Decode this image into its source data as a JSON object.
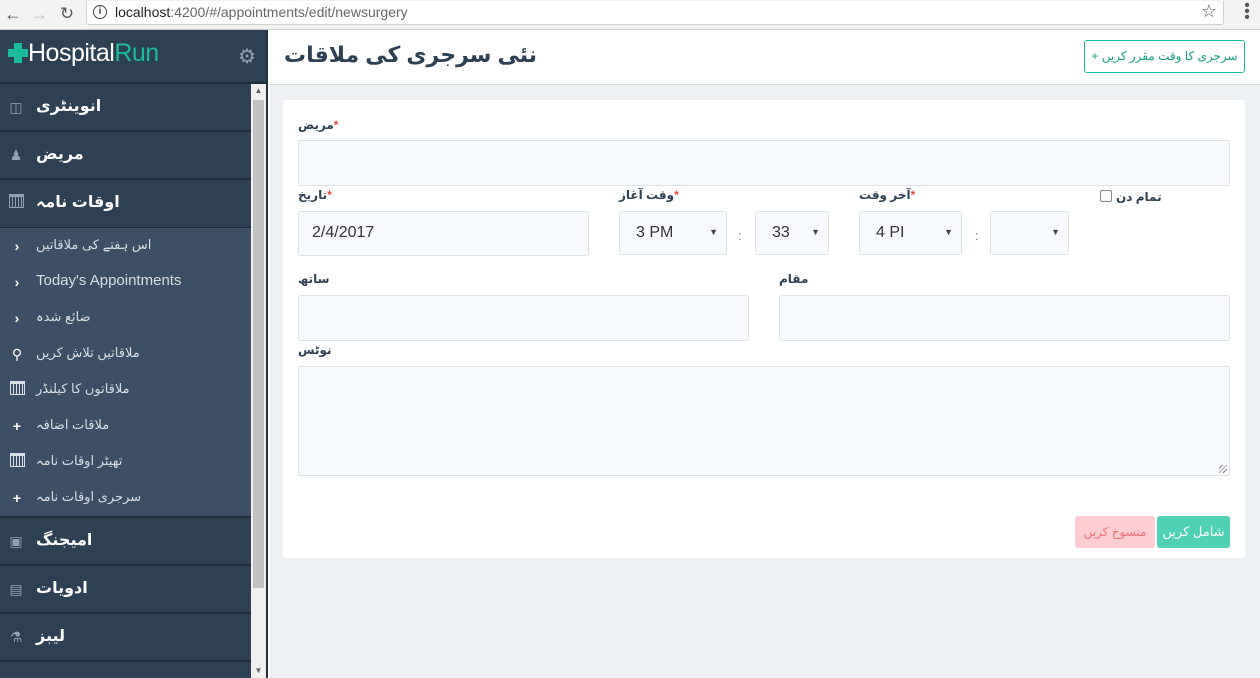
{
  "browser": {
    "url_host": "localhost",
    "url_rest": ":4200/#/appointments/edit/newsurgery",
    "back_icon": "back-arrow-icon",
    "forward_icon": "forward-arrow-icon",
    "reload_icon": "reload-icon",
    "star_icon": "bookmark-star-icon",
    "menu_icon": "kebab-menu-icon"
  },
  "brand": {
    "hospital": "Hospital",
    "run": "Run",
    "settings_icon": "gear-icon"
  },
  "sidebar": {
    "categories": [
      {
        "label": "انوینٹری",
        "icon": "inventory-box-icon"
      },
      {
        "label": "مریض",
        "icon": "patients-icon"
      },
      {
        "label": "اوقات نامہ",
        "icon": "calendar-icon"
      }
    ],
    "sub_items": [
      {
        "label": "اس ہفتے کی ملاقاتیں",
        "icon": "chevron-right-icon"
      },
      {
        "label": "Today's Appointments",
        "icon": "chevron-right-icon"
      },
      {
        "label": "ضائع شدہ",
        "icon": "chevron-right-icon"
      },
      {
        "label": "ملاقاتیں تلاش کریں",
        "icon": "search-icon"
      },
      {
        "label": "ملاقاتوں کا کیلنڈر",
        "icon": "calendar-icon"
      },
      {
        "label": "ملاقات اضافہ",
        "icon": "plus-icon"
      },
      {
        "label": "تھیٹر اوقات نامہ",
        "icon": "calendar-icon"
      },
      {
        "label": "سرجری اوقات نامہ",
        "icon": "plus-icon"
      }
    ],
    "categories_after": [
      {
        "label": "امیجنگ",
        "icon": "camera-icon"
      },
      {
        "label": "ادویات",
        "icon": "document-icon"
      },
      {
        "label": "لیبز",
        "icon": "microscope-icon"
      }
    ]
  },
  "header": {
    "title": "نئی سرجری کی ملاقات",
    "new_button": "سرجری کا وقت مقرر کریں +"
  },
  "form": {
    "patient": {
      "label": "مریض",
      "value": ""
    },
    "date": {
      "label": "تاریخ",
      "value": "2/4/2017"
    },
    "start_time": {
      "label": "وقت آغاز",
      "hour": "3 PM",
      "minute": "33"
    },
    "end_time": {
      "label": "آخر وقت",
      "hour": "4 PI",
      "minute": ""
    },
    "all_day": {
      "label": "تمام دن",
      "checked": false
    },
    "with": {
      "label": "ساتھ",
      "value": ""
    },
    "location": {
      "label": "مقام",
      "value": ""
    },
    "notes": {
      "label": "نوٹس",
      "value": ""
    },
    "required_mark": "*",
    "time_separator": ":",
    "add_button": "شامل کریں",
    "cancel_button": "منسوخ کریں"
  },
  "colors": {
    "sidebar_bg": "#2e4053",
    "accent": "#1abc9c",
    "add_button": "#4fd1b6",
    "cancel_button": "#ffcdd2"
  }
}
